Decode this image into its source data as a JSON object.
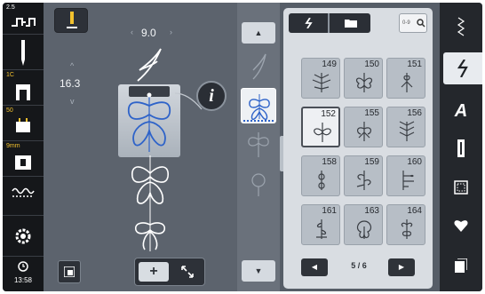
{
  "status": {
    "upper_tension": "2.5",
    "feed_dog_label": "1C",
    "tension_value": "50",
    "stitch_height_label": "9mm",
    "clock": "13:58"
  },
  "stitch_settings": {
    "stitch_width": "9.0",
    "stitch_length": "16.3",
    "info_label": "i"
  },
  "zoom": {
    "plus_label": "+"
  },
  "grid": {
    "page_indicator": "5 / 6",
    "stitches": [
      {
        "number": "149",
        "selected": false
      },
      {
        "number": "150",
        "selected": false
      },
      {
        "number": "151",
        "selected": false
      },
      {
        "number": "152",
        "selected": true
      },
      {
        "number": "155",
        "selected": false
      },
      {
        "number": "156",
        "selected": false
      },
      {
        "number": "158",
        "selected": false
      },
      {
        "number": "159",
        "selected": false
      },
      {
        "number": "160",
        "selected": false
      },
      {
        "number": "161",
        "selected": false
      },
      {
        "number": "163",
        "selected": false
      },
      {
        "number": "164",
        "selected": false
      }
    ]
  },
  "categories": {
    "alphabet_label": "A"
  },
  "colors": {
    "status_yellow": "#f2c12e",
    "stitch_blue": "#2e63c9"
  },
  "icons": [
    "tension-icon",
    "needle-icon",
    "feed-dog-icon",
    "thread-tension-icon",
    "stitch-plate-icon",
    "wave-icon",
    "settings-icon",
    "clock-icon",
    "needle-position-icon",
    "info-icon",
    "view-icon",
    "zoom-fit-icon",
    "search-icon",
    "folder-icon",
    "heart-icon"
  ]
}
